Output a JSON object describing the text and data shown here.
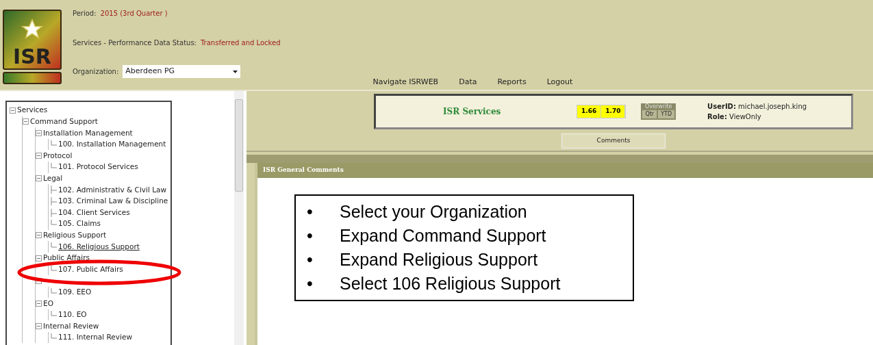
{
  "header": {
    "period_label": "Period:",
    "period_value": "2015 (3rd Quarter )",
    "status_label": "Services - Performance Data Status:",
    "status_value": "Transferred and Locked",
    "organization_label": "Organization:",
    "organization_value": "Aberdeen PG",
    "logo_text": "ISR"
  },
  "nav": [
    "Navigate ISRWEB",
    "Data",
    "Reports",
    "Logout"
  ],
  "tree": [
    {
      "label": "Services",
      "expanded": true,
      "children": [
        {
          "label": "Command Support",
          "expanded": true,
          "children": [
            {
              "label": "Installation Management",
              "expanded": true,
              "children": [
                {
                  "label": "100. Installation Management",
                  "selected": false
                }
              ]
            },
            {
              "label": "Protocol",
              "expanded": true,
              "children": [
                {
                  "label": "101. Protocol Services",
                  "selected": false
                }
              ]
            },
            {
              "label": "Legal",
              "expanded": true,
              "children": [
                {
                  "label": "102. Administrativ & Civil Law",
                  "selected": false
                },
                {
                  "label": "103. Criminal Law & Discipline",
                  "selected": false
                },
                {
                  "label": "104. Client Services",
                  "selected": false
                },
                {
                  "label": "105. Claims",
                  "selected": false
                }
              ]
            },
            {
              "label": "Religious Support",
              "expanded": true,
              "children": [
                {
                  "label": "106. Religious Support",
                  "selected": true
                }
              ]
            },
            {
              "label": "Public Affairs",
              "expanded": true,
              "children": [
                {
                  "label": "107. Public Affairs",
                  "selected": false
                }
              ]
            },
            {
              "expanded": true,
              "children": [
                {
                  "label": "109. EEO",
                  "selected": false
                }
              ]
            },
            {
              "label": "EO",
              "expanded": true,
              "children": [
                {
                  "label": "110. EO",
                  "selected": false
                }
              ]
            },
            {
              "label": "Internal Review",
              "expanded": true,
              "children": [
                {
                  "label": "111. Internal Review",
                  "selected": false
                }
              ]
            }
          ]
        }
      ]
    }
  ],
  "info_bar": {
    "title": "ISR Services",
    "scores": [
      "1.66",
      "1.70"
    ],
    "overwrite_label": "Overwrite",
    "overwrite_buttons": [
      "Qtr",
      "YTD"
    ],
    "user_label": "UserID:",
    "user_value": "michael.joseph.king",
    "role_label": "Role:",
    "role_value": "ViewOnly"
  },
  "tabs": [
    {
      "label": "Comments",
      "selected": true
    }
  ],
  "comments_panel": {
    "title": "ISR General Comments",
    "instructions": [
      {
        "bullet": "•",
        "text": "Select your Organization"
      },
      {
        "bullet": "•",
        "text": "Expand Command Support"
      },
      {
        "bullet": "•",
        "text": "Expand Religious Support"
      },
      {
        "bullet": "•",
        "text": "Select 106 Religious Support"
      }
    ]
  }
}
